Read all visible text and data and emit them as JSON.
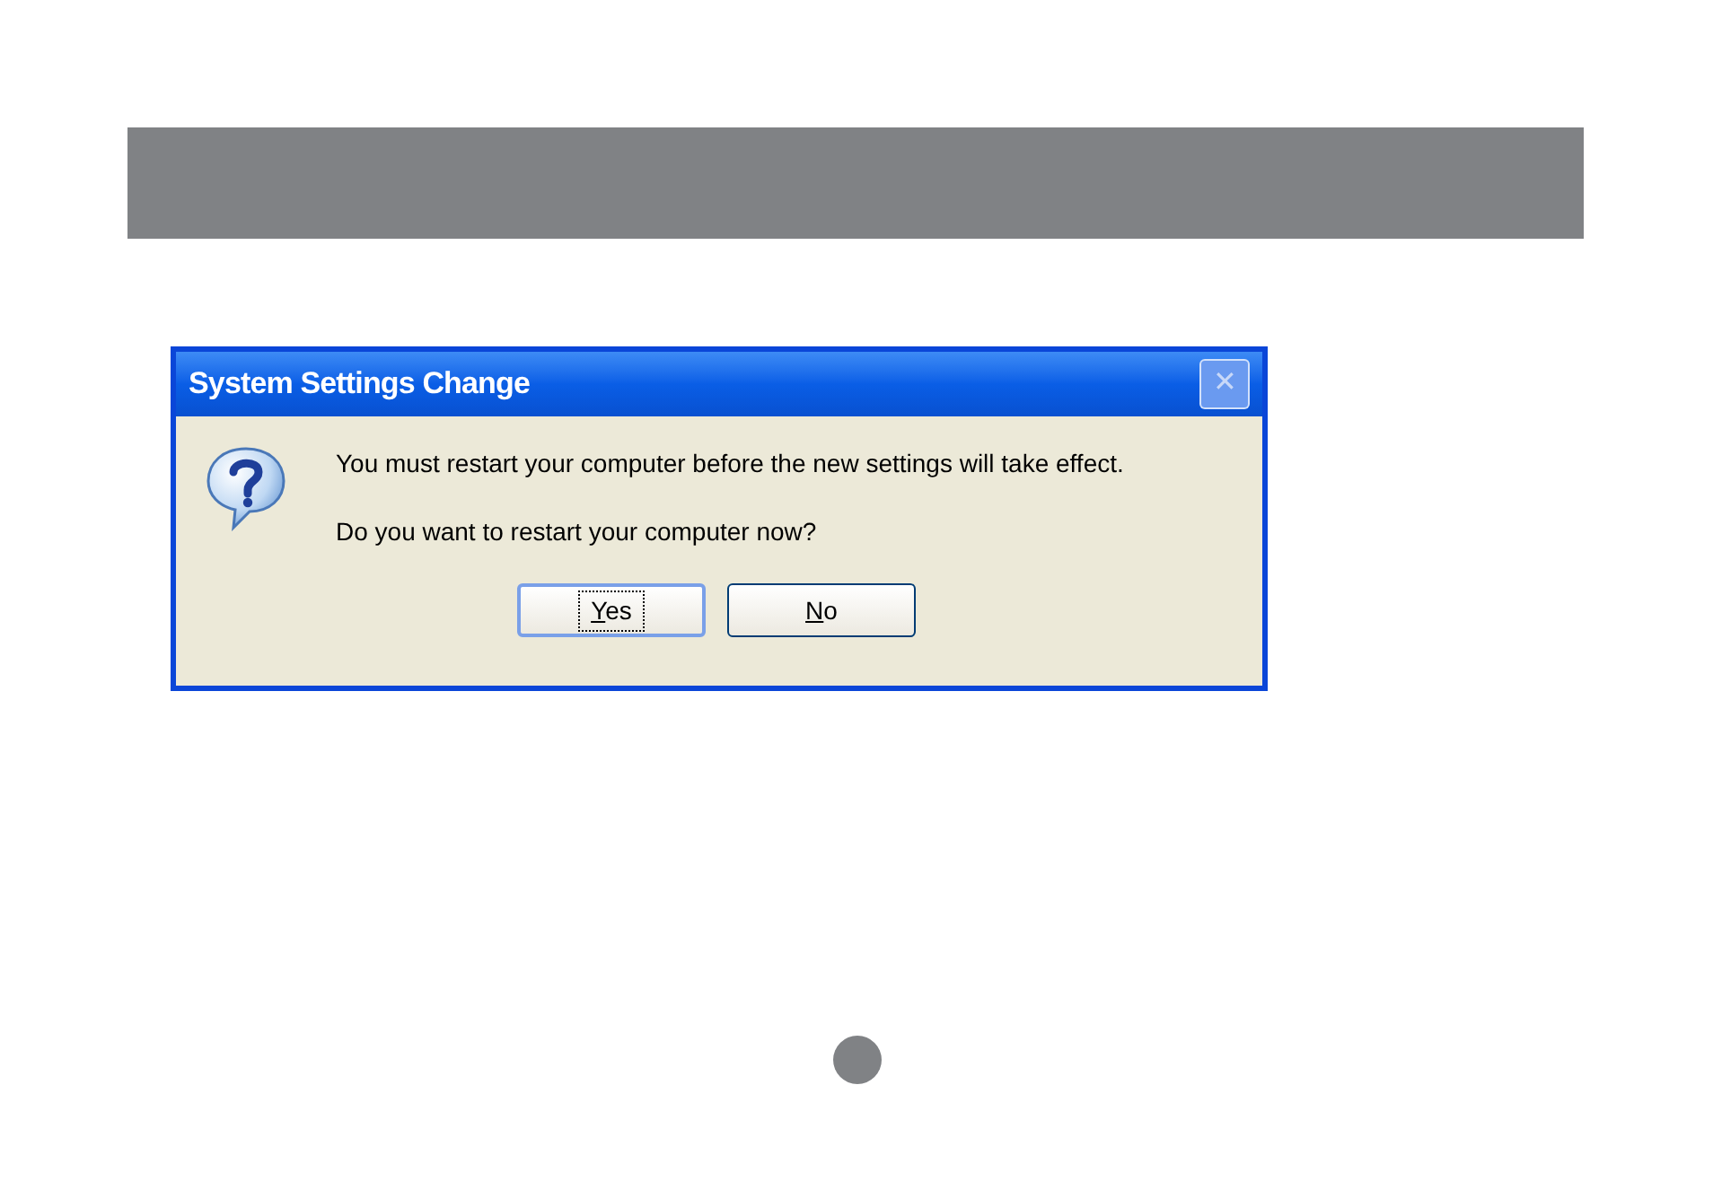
{
  "dialog": {
    "title": "System Settings Change",
    "close_button": {
      "label": "✕",
      "disabled": true
    },
    "messages": [
      "You must restart your computer before the new settings will take effect.",
      "Do you want to restart your computer now?"
    ],
    "buttons": [
      {
        "label": "Yes",
        "mnemonic_underlined": true,
        "focused": true
      },
      {
        "label": "No",
        "mnemonic_underlined": true,
        "focused": false
      }
    ]
  }
}
